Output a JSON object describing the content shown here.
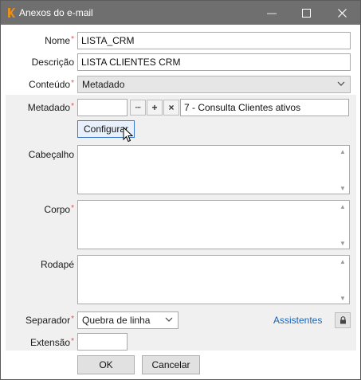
{
  "window": {
    "title": "Anexos do e-mail",
    "controls": {
      "minimize": "—",
      "maximize": "☐",
      "close": "✕"
    },
    "accent": "#e8901a"
  },
  "form": {
    "nome": {
      "label": "Nome",
      "value": "LISTA_CRM"
    },
    "descricao": {
      "label": "Descrição",
      "value": "LISTA CLIENTES CRM"
    },
    "conteudo": {
      "label": "Conteúdo",
      "value": "Metadado"
    },
    "metadado": {
      "label": "Metadado",
      "code": "",
      "ellipsis_label": "···",
      "add_label": "+",
      "remove_label": "×",
      "description": "7 - Consulta Clientes ativos"
    },
    "configurar_label": "Configurar",
    "cabecalho": {
      "label": "Cabeçalho",
      "value": ""
    },
    "corpo": {
      "label": "Corpo",
      "value": ""
    },
    "rodape": {
      "label": "Rodapé",
      "value": ""
    },
    "separador": {
      "label": "Separador",
      "value": "Quebra de linha"
    },
    "assistentes_label": "Assistentes",
    "extensao": {
      "label": "Extensão",
      "value": ""
    },
    "required_mark": "*"
  },
  "buttons": {
    "ok": "OK",
    "cancel": "Cancelar"
  }
}
